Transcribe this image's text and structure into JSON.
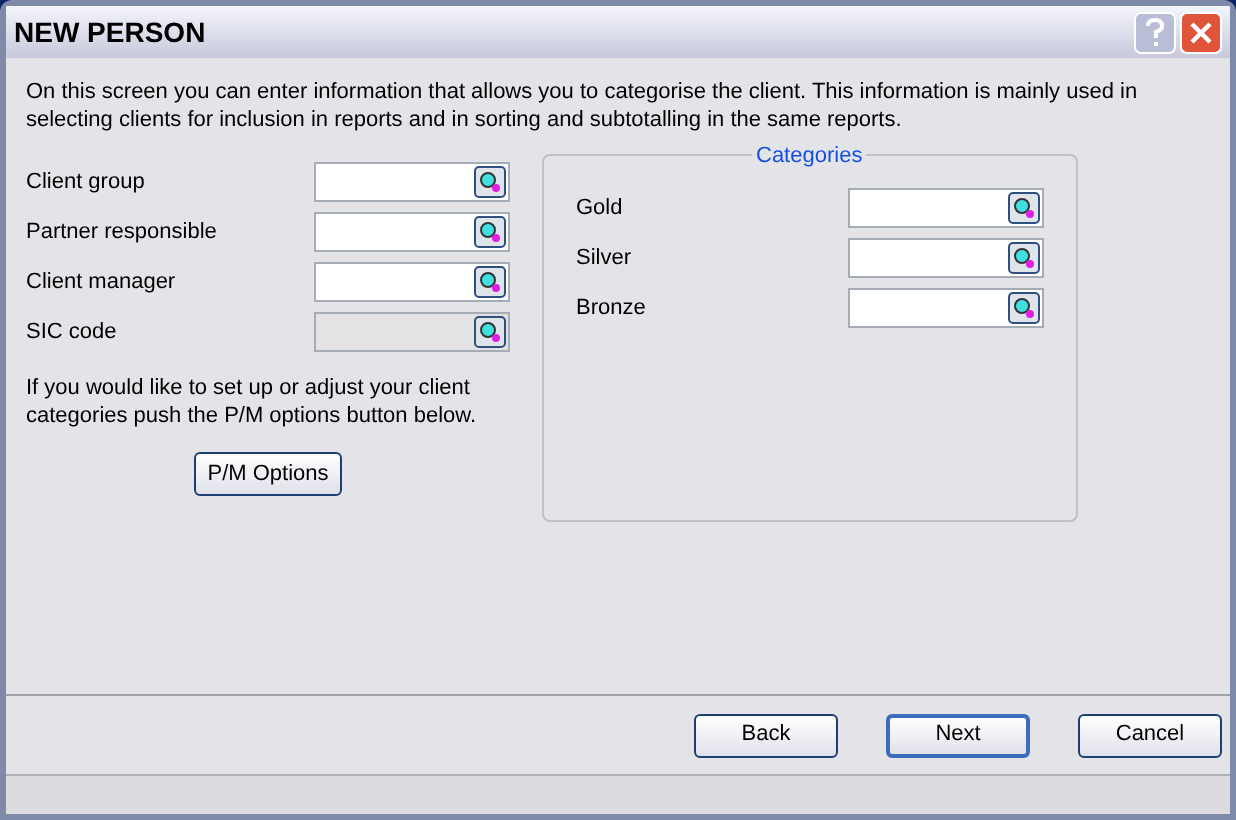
{
  "window": {
    "title": "NEW PERSON"
  },
  "intro": "On this screen you can enter information that allows you to categorise the client. This information is mainly used in selecting clients for inclusion in reports and in sorting and subtotalling in the same reports.",
  "fields": [
    {
      "label": "Client group",
      "disabled": false
    },
    {
      "label": "Partner responsible",
      "disabled": false
    },
    {
      "label": "Client manager",
      "disabled": false
    },
    {
      "label": "SIC code",
      "disabled": true
    }
  ],
  "hint": "If you would like to set up or adjust your client categories push the P/M options button below.",
  "options_button": "P/M Options",
  "categories": {
    "title": "Categories",
    "fields": [
      {
        "label": "Gold",
        "disabled": false
      },
      {
        "label": "Silver",
        "disabled": false
      },
      {
        "label": "Bronze",
        "disabled": false
      }
    ]
  },
  "buttons": [
    {
      "label": "Back",
      "default": false
    },
    {
      "label": "Next",
      "default": true
    },
    {
      "label": "Cancel",
      "default": false
    }
  ]
}
